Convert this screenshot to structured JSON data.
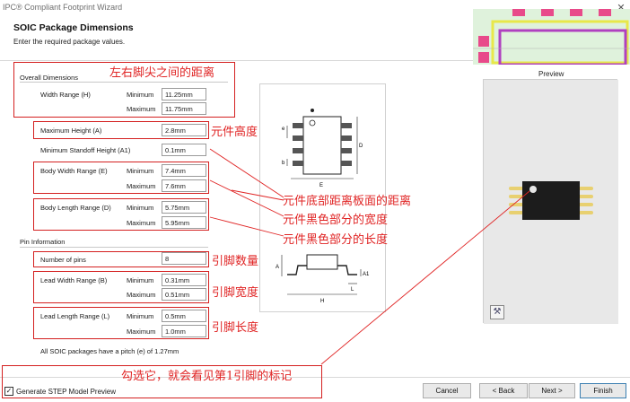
{
  "window": {
    "title": "IPC® Compliant Footprint Wizard",
    "close_glyph": "✕"
  },
  "header": {
    "title": "SOIC Package Dimensions",
    "subtitle": "Enter the required package values."
  },
  "overall": {
    "section_label": "Overall Dimensions",
    "width_range_label": "Width Range (H)",
    "min_label": "Minimum",
    "max_label": "Maximum",
    "width_min": "11.25mm",
    "width_max": "11.75mm"
  },
  "max_height": {
    "label": "Maximum Height (A)",
    "value": "2.8mm"
  },
  "standoff": {
    "label": "Minimum Standoff Height (A1)",
    "value": "0.1mm"
  },
  "body_width": {
    "label": "Body Width Range (E)",
    "min_label": "Minimum",
    "max_label": "Maximum",
    "min": "7.4mm",
    "max": "7.6mm"
  },
  "body_length": {
    "label": "Body Length Range (D)",
    "min_label": "Minimum",
    "max_label": "Maximum",
    "min": "5.75mm",
    "max": "5.95mm"
  },
  "pin_info": {
    "section_label": "Pin Information",
    "num_pins_label": "Number of pins",
    "num_pins": "8",
    "lead_width_label": "Lead Width Range (B)",
    "lead_width_min": "0.31mm",
    "lead_width_max": "0.51mm",
    "lead_length_label": "Lead Length Range (L)",
    "lead_length_min": "0.5mm",
    "lead_length_max": "1.0mm",
    "min_label": "Minimum",
    "max_label": "Maximum",
    "pitch_note": "All SOIC packages have a pitch (e) of 1.27mm"
  },
  "diagram": {
    "labels": {
      "e": "e",
      "b": "b",
      "d": "D",
      "e_bottom": "E",
      "a": "A",
      "a1": "A1",
      "l": "L",
      "h": "H"
    }
  },
  "preview": {
    "label": "Preview"
  },
  "footer": {
    "step_label": "Generate STEP Model Preview",
    "step_checked": "✓",
    "cancel": "Cancel",
    "back": "< Back",
    "next": "Next >",
    "finish": "Finish"
  },
  "annotations": {
    "width_note": "左右脚尖之间的距离",
    "height_note": "元件高度",
    "standoff_note": "元件底部距离板面的距离",
    "body_width_note": "元件黑色部分的宽度",
    "body_length_note": "元件黑色部分的长度",
    "pins_note": "引脚数量",
    "lead_width_note": "引脚宽度",
    "lead_length_note": "引脚长度",
    "step_note": "勾选它，就会看见第1引脚的标记"
  },
  "colors": {
    "annotation_red": "#e02424",
    "pcb_green": "#dff2dc",
    "chip_body": "#1c1c1c",
    "lead_gold": "#e8d070"
  }
}
